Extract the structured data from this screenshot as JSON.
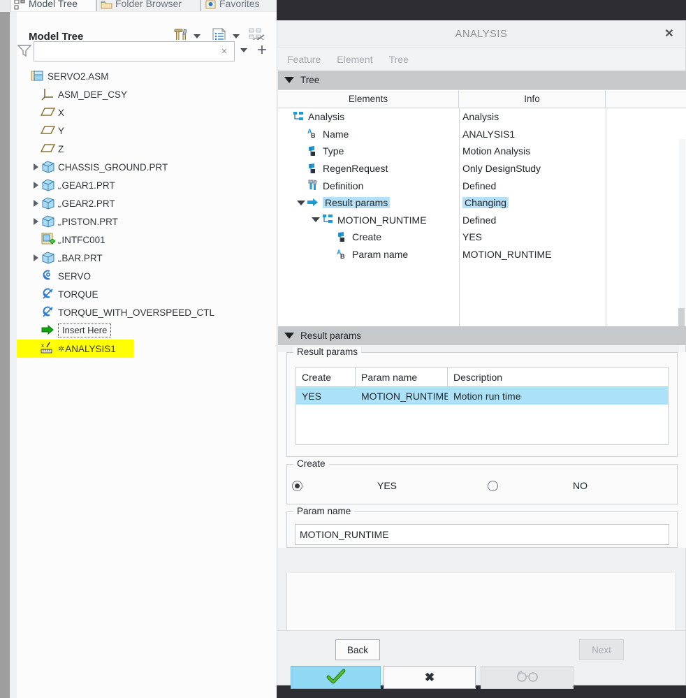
{
  "window": {
    "tabs": [
      {
        "label": "Model Tree",
        "icon": "model-tree-icon",
        "active": true
      },
      {
        "label": "Folder Browser",
        "icon": "folder-icon",
        "active": false
      },
      {
        "label": "Favorites",
        "icon": "favorites-icon",
        "active": false
      }
    ]
  },
  "model_tree": {
    "title": "Model Tree",
    "toolbar": [
      {
        "name": "settings-tools-icon"
      },
      {
        "name": "chevron-down-icon"
      },
      {
        "name": "display-list-icon"
      },
      {
        "name": "chevron-down-icon"
      },
      {
        "name": "tree-filter-off-icon"
      }
    ],
    "filter": {
      "icon": "filter-funnel-icon",
      "value": "",
      "placeholder": "",
      "clear_label": "×",
      "dropdown_icon": "chevron-down-icon",
      "add_label": "+"
    },
    "items": [
      {
        "label": "SERVO2.ASM",
        "indent": 0,
        "icon": "assembly-icon",
        "expander": false,
        "prefix": "",
        "highlight": false
      },
      {
        "label": "ASM_DEF_CSY",
        "indent": 1,
        "icon": "coordinate-system-icon",
        "expander": false,
        "prefix": "",
        "highlight": false
      },
      {
        "label": "X",
        "indent": 1,
        "icon": "datum-plane-icon",
        "expander": false,
        "prefix": "",
        "highlight": false
      },
      {
        "label": "Y",
        "indent": 1,
        "icon": "datum-plane-icon",
        "expander": false,
        "prefix": "",
        "highlight": false
      },
      {
        "label": "Z",
        "indent": 1,
        "icon": "datum-plane-icon",
        "expander": false,
        "prefix": "",
        "highlight": false
      },
      {
        "label": "CHASSIS_GROUND.PRT",
        "indent": 1,
        "icon": "part-icon",
        "expander": true,
        "prefix": "",
        "highlight": false
      },
      {
        "label": "GEAR1.PRT",
        "indent": 1,
        "icon": "part-icon",
        "expander": true,
        "prefix": "⎵",
        "highlight": false
      },
      {
        "label": "GEAR2.PRT",
        "indent": 1,
        "icon": "part-icon",
        "expander": true,
        "prefix": "⎵",
        "highlight": false
      },
      {
        "label": "PISTON.PRT",
        "indent": 1,
        "icon": "part-icon",
        "expander": true,
        "prefix": "⎵",
        "highlight": false
      },
      {
        "label": "INTFC001",
        "indent": 1,
        "icon": "interface-icon",
        "expander": false,
        "prefix": "⎵",
        "highlight": false
      },
      {
        "label": "BAR.PRT",
        "indent": 1,
        "icon": "part-icon",
        "expander": true,
        "prefix": "⎵",
        "highlight": false
      },
      {
        "label": "SERVO",
        "indent": 1,
        "icon": "servo-motor-icon",
        "expander": false,
        "prefix": "",
        "highlight": false
      },
      {
        "label": "TORQUE",
        "indent": 1,
        "icon": "force-motor-icon",
        "expander": false,
        "prefix": "",
        "highlight": false
      },
      {
        "label": "TORQUE_WITH_OVERSPEED_CTL",
        "indent": 1,
        "icon": "force-motor-icon",
        "expander": false,
        "prefix": "",
        "highlight": false
      },
      {
        "label": "Insert Here",
        "indent": 1,
        "icon": "insert-arrow-icon",
        "expander": false,
        "prefix": "",
        "highlight": false,
        "dotted": true
      },
      {
        "label": "ANALYSIS1",
        "indent": 1,
        "icon": "analysis-measure-icon",
        "expander": false,
        "prefix": "✲",
        "highlight": true
      }
    ]
  },
  "dialog": {
    "title": "ANALYSIS",
    "close_label": "✕",
    "menu": [
      "Feature",
      "Element",
      "Tree"
    ],
    "tree_section": {
      "header": "Tree",
      "columns": [
        "Elements",
        "Info",
        ""
      ],
      "rows": [
        {
          "element": "Analysis",
          "info": "Analysis",
          "indent": 0,
          "icon": "feature-node-icon",
          "expander": "",
          "selected": false
        },
        {
          "element": "Name",
          "info": "ANALYSIS1",
          "indent": 1,
          "icon": "string-param-icon",
          "expander": "",
          "selected": false
        },
        {
          "element": "Type",
          "info": "Motion Analysis",
          "indent": 1,
          "icon": "option-param-icon",
          "expander": "",
          "selected": false
        },
        {
          "element": "RegenRequest",
          "info": "Only DesignStudy",
          "indent": 1,
          "icon": "option-param-icon",
          "expander": "",
          "selected": false
        },
        {
          "element": "Definition",
          "info": "Defined",
          "indent": 1,
          "icon": "definition-icon",
          "expander": "",
          "selected": false
        },
        {
          "element": "Result params",
          "info": "Changing",
          "indent": 1,
          "icon": "arrow-node-icon",
          "expander": "down",
          "selected": true
        },
        {
          "element": "MOTION_RUNTIME",
          "info": "Defined",
          "indent": 2,
          "icon": "feature-node-icon",
          "expander": "down",
          "selected": false
        },
        {
          "element": "Create",
          "info": "YES",
          "indent": 3,
          "icon": "option-param-icon",
          "expander": "",
          "selected": false
        },
        {
          "element": "Param name",
          "info": "MOTION_RUNTIME",
          "indent": 3,
          "icon": "string-param-icon",
          "expander": "",
          "selected": false
        }
      ]
    },
    "result_section": {
      "header": "Result params",
      "group_label": "Result params",
      "columns": [
        "Create",
        "Param name",
        "Description"
      ],
      "rows": [
        {
          "create": "YES",
          "param_name": "MOTION_RUNTIME",
          "description": "Motion run time",
          "selected": true
        }
      ]
    },
    "create_group": {
      "label": "Create",
      "options": [
        {
          "label": "YES",
          "selected": true
        },
        {
          "label": "NO",
          "selected": false
        }
      ]
    },
    "param_group": {
      "label": "Param name",
      "value": "MOTION_RUNTIME"
    },
    "footer": {
      "back_label": "Back",
      "next_label": "Next",
      "ok_icon": "check-mark-icon",
      "cancel_icon": "x-mark-icon",
      "preview_icon": "glasses-preview-icon"
    }
  },
  "colors": {
    "selection_blue": "#b5e0f7",
    "row_highlight_blue": "#ace2f7",
    "tree_highlight_yellow": "#ffff00",
    "ok_button_blue": "#8fd9f5",
    "section_header_gray": "#c6c9cc",
    "dark_background": "#2d2d33"
  }
}
